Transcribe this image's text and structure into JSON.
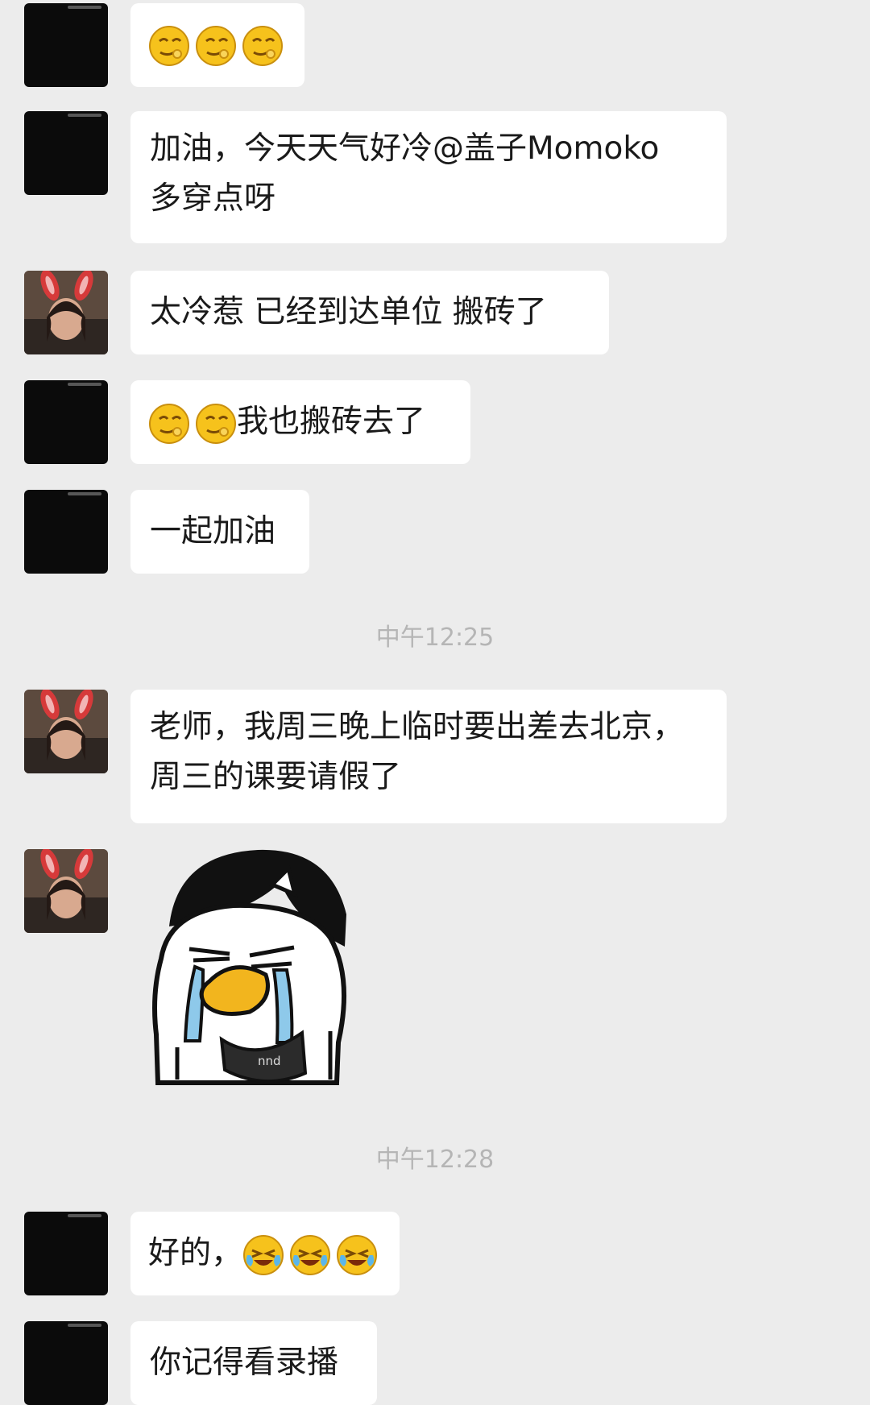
{
  "messages": [
    {
      "id": "m1",
      "avatar": "black",
      "text": "",
      "emojis": [
        "smirk-face-icon",
        "smirk-face-icon",
        "smirk-face-icon"
      ]
    },
    {
      "id": "m2",
      "avatar": "black",
      "lines": [
        "加油，今天天气好冷@盖子Momoko",
        "多穿点呀"
      ]
    },
    {
      "id": "m3",
      "avatar": "photo",
      "text": "太冷惹 已经到达单位 搬砖了"
    },
    {
      "id": "m4",
      "avatar": "black",
      "text": "我也搬砖去了",
      "emojis": [
        "smirk-face-icon",
        "smirk-face-icon"
      ]
    },
    {
      "id": "m5",
      "avatar": "black",
      "text": "一起加油"
    },
    {
      "id": "m6",
      "avatar": "photo",
      "lines": [
        "老师，我周三晚上临时要出差去北京，",
        "周三的课要请假了"
      ]
    },
    {
      "id": "m7",
      "avatar": "photo",
      "sticker": "crying-duck-sticker",
      "sticker_text": "nnd"
    },
    {
      "id": "m8",
      "avatar": "black",
      "text": "好的，",
      "emojis": [
        "tears-of-joy-icon",
        "tears-of-joy-icon",
        "tears-of-joy-icon"
      ]
    },
    {
      "id": "m9",
      "avatar": "black",
      "text": "你记得看录播"
    }
  ],
  "timestamps": [
    "中午12:25",
    "中午12:28"
  ],
  "colors": {
    "background": "#ececec",
    "bubble": "#ffffff",
    "timestamp": "#b5b5b5",
    "emoji_yellow": "#f6c21c"
  }
}
